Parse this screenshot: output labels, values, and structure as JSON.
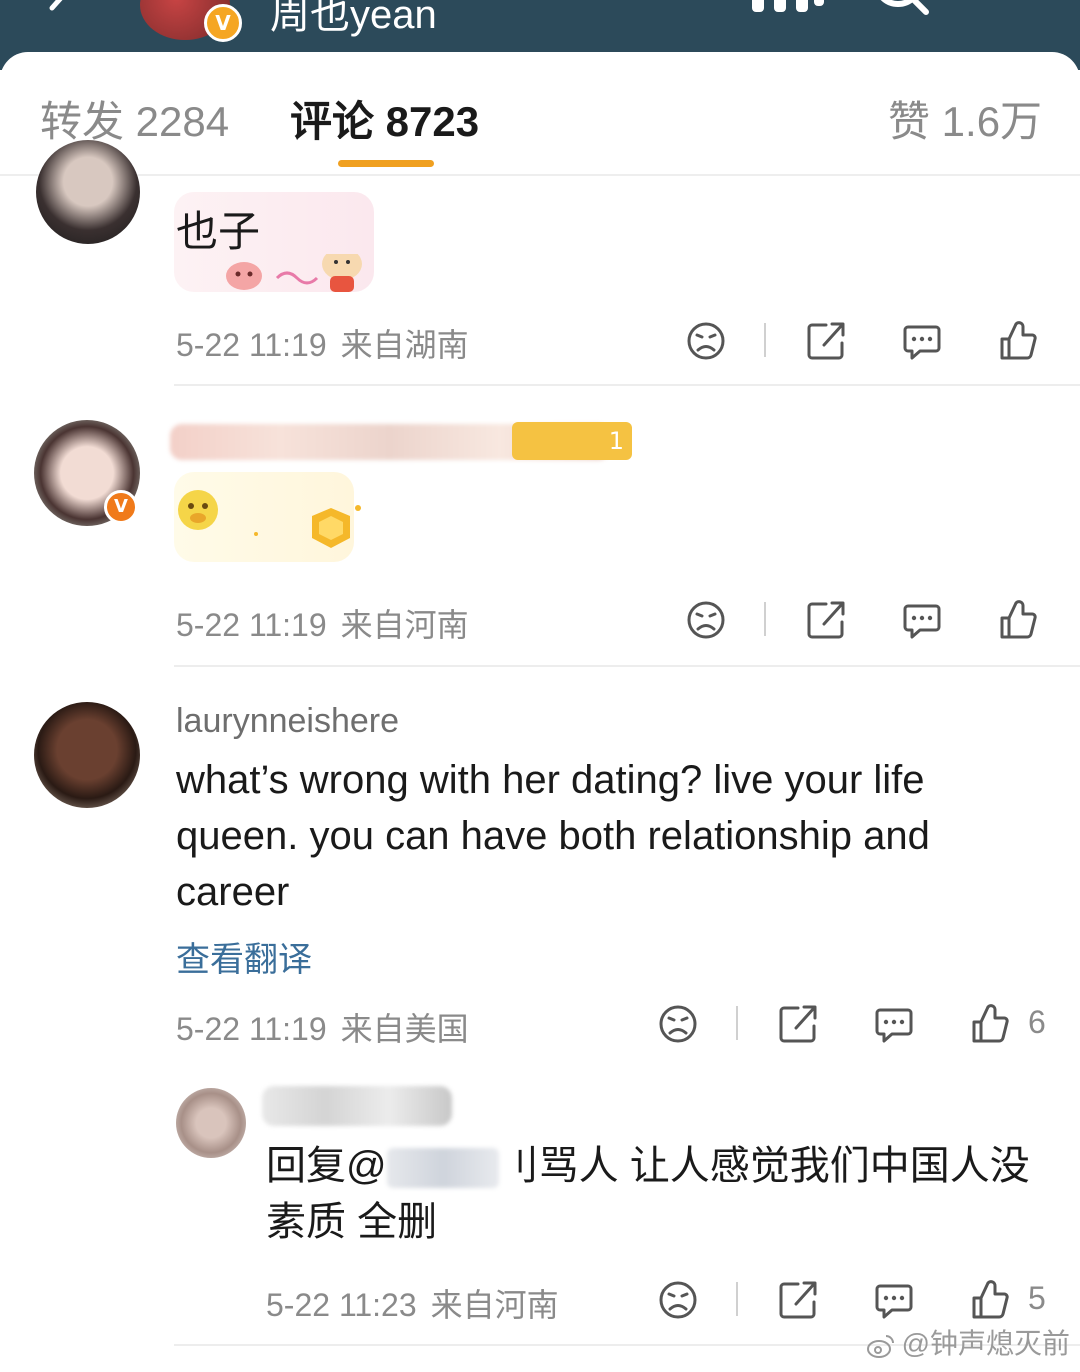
{
  "header": {
    "username": "周也yean",
    "verified_badge": "V"
  },
  "tabs": [
    {
      "label": "转发 2284",
      "active": false
    },
    {
      "label": "评论 8723",
      "active": true
    },
    {
      "label": "赞 1.6万",
      "active": false
    }
  ],
  "comments": [
    {
      "text": "也子",
      "time": "5-22 11:19",
      "location": "来自湖南"
    },
    {
      "time": "5-22 11:19",
      "location": "来自河南",
      "badge_text": "1"
    },
    {
      "username": "laurynneishere",
      "text_lines": [
        "what’s wrong with her dating? live your life",
        "queen. you can have both relationship and",
        "career"
      ],
      "translate_label": "查看翻译",
      "time": "5-22 11:19",
      "location": "来自美国",
      "like_count": "6"
    },
    {
      "is_reply": true,
      "text_line1_prefix": "回复@",
      "text_line1_suffix": "刂骂人 让人感觉我们中国人没",
      "text_line2": "素质 全删",
      "time": "5-22 11:23",
      "location": "来自河南",
      "like_count": "5"
    }
  ],
  "watermark": "@钟声熄灭前",
  "colors": {
    "header_bg": "#2c4a5a",
    "tab_underline": "#f0a020",
    "link": "#3a6e9a",
    "verified": "#f5a623"
  }
}
